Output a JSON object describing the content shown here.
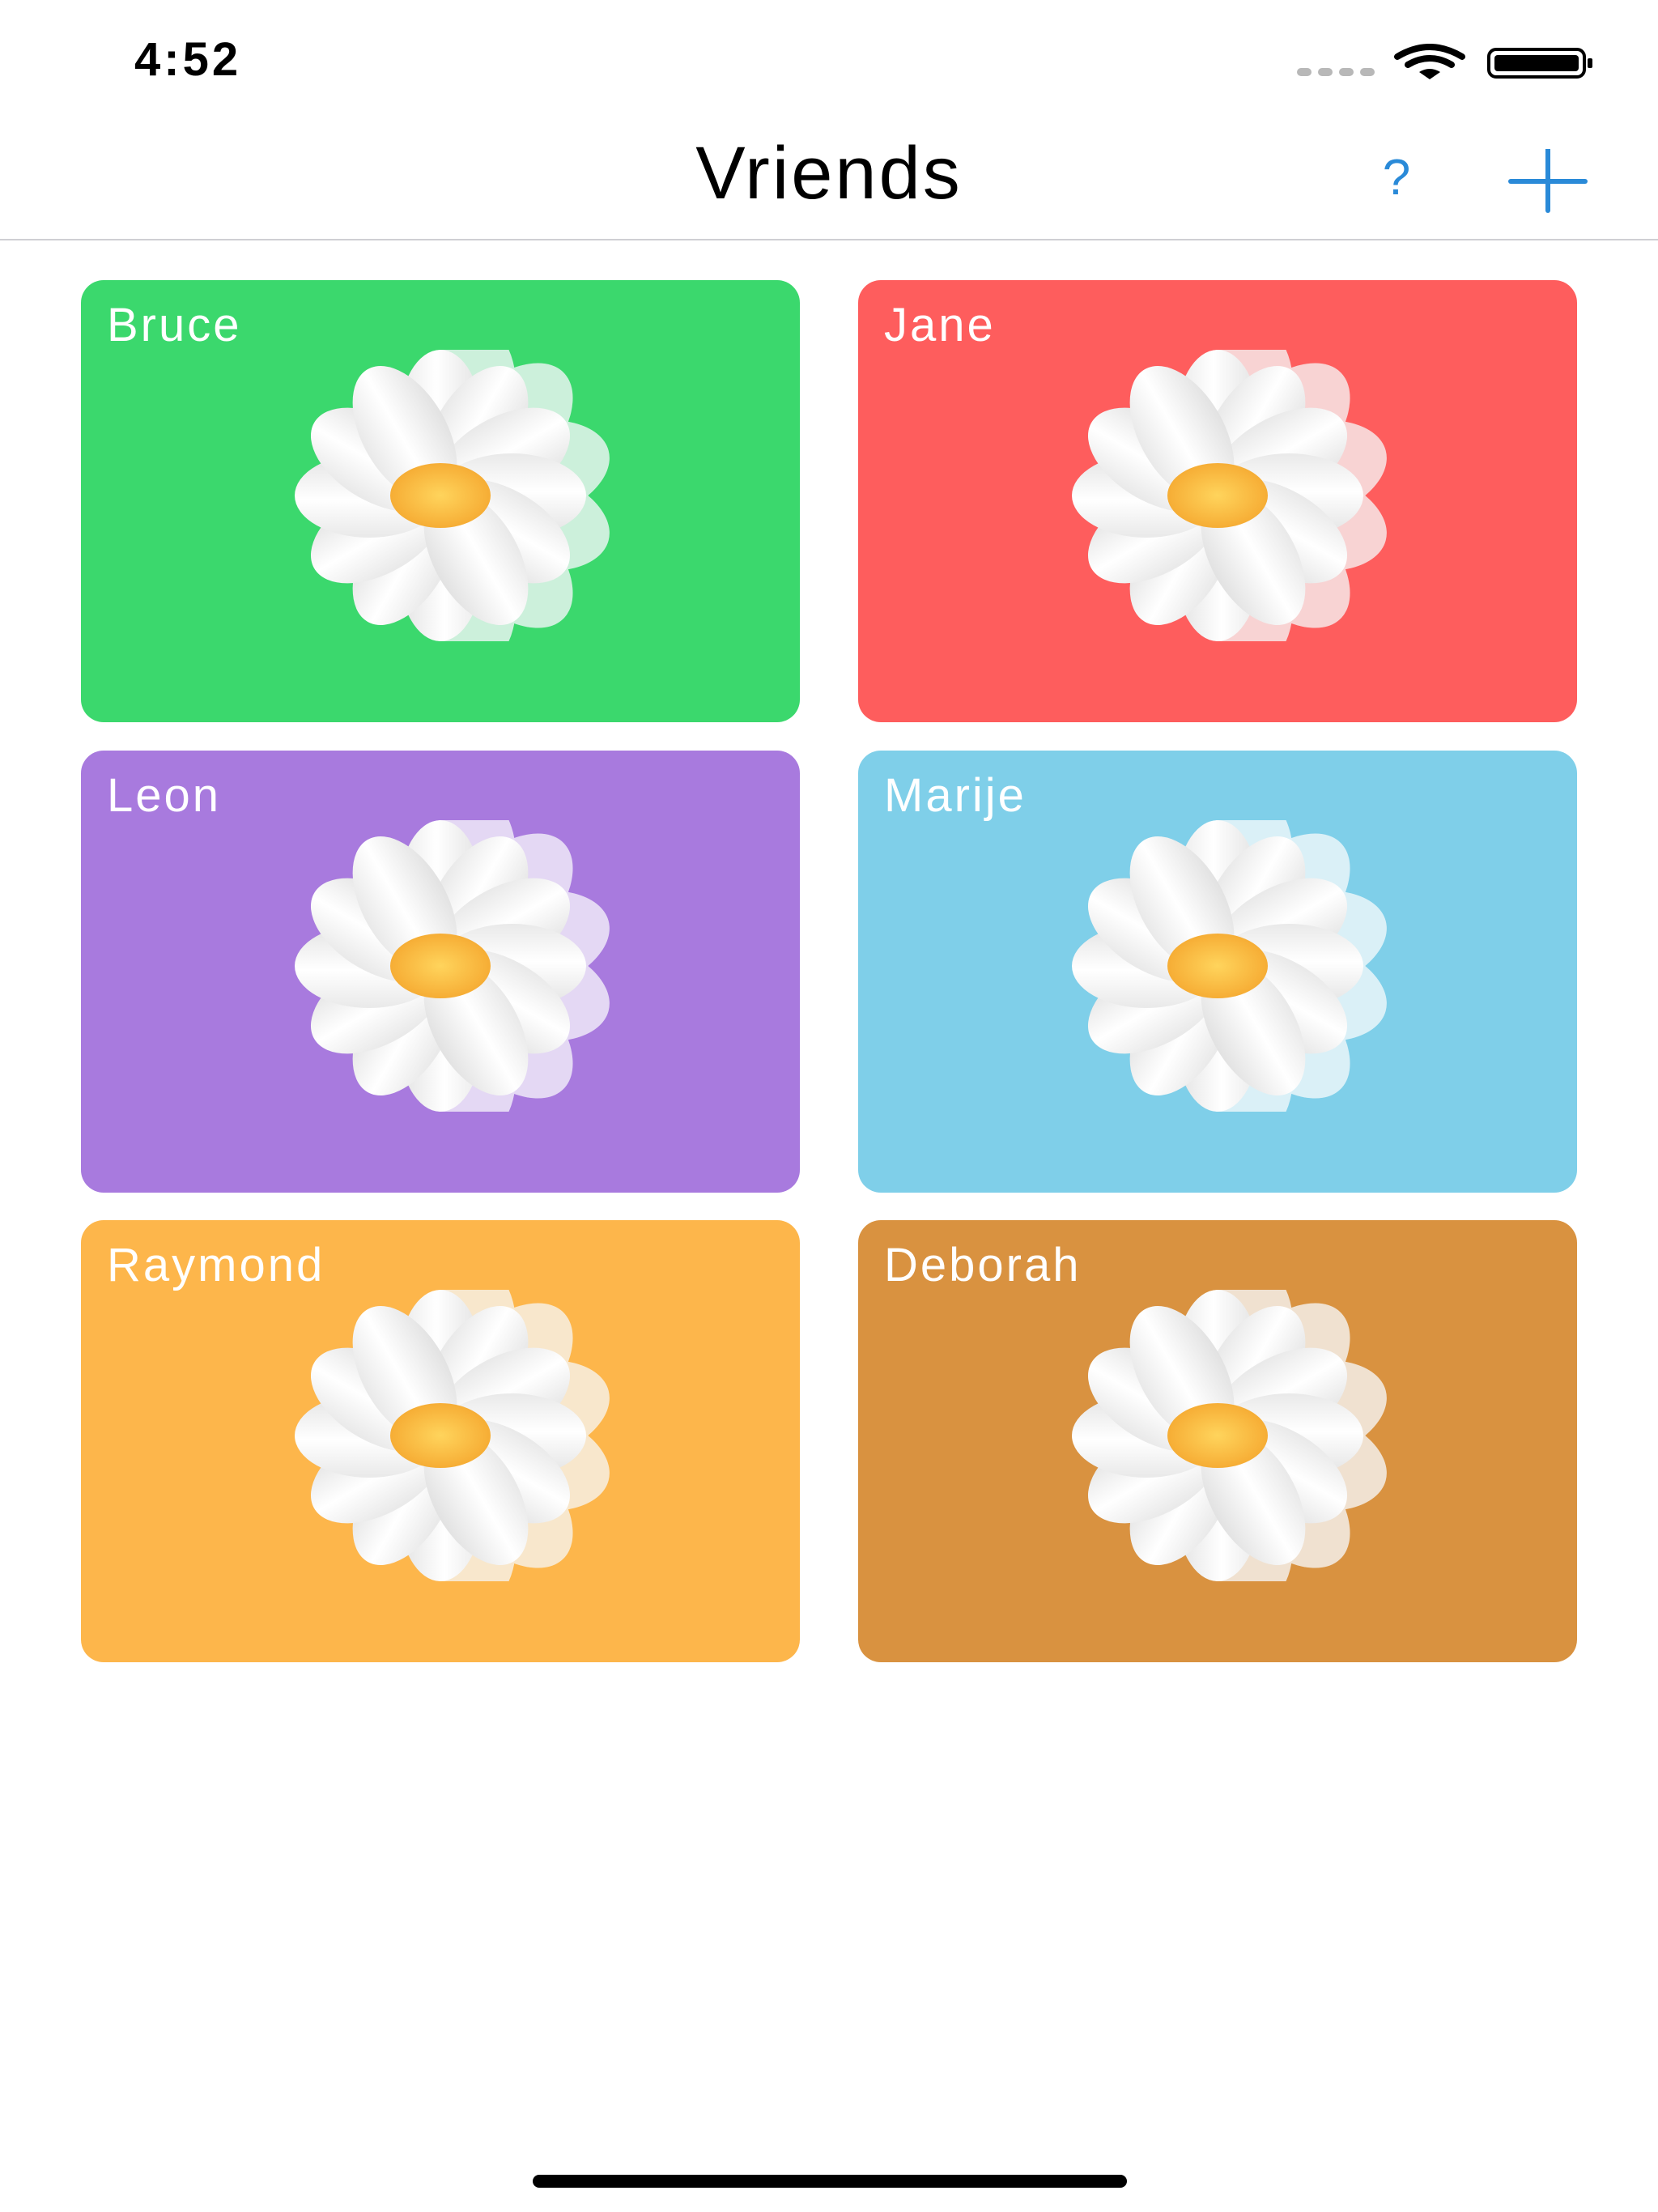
{
  "status_bar": {
    "time": "4:52",
    "signal_icon": "cellular-dots-icon",
    "wifi_icon": "wifi-icon",
    "battery_icon": "battery-icon"
  },
  "nav": {
    "title": "Vriends",
    "help_label": "?",
    "add_icon": "plus-icon",
    "accent_color": "#2a8ad8"
  },
  "friends": [
    {
      "name": "Bruce",
      "color": "#3bd86d",
      "petal_tint": "#d4f1e1"
    },
    {
      "name": "Jane",
      "color": "#fe5d5d",
      "petal_tint": "#f8d9d9"
    },
    {
      "name": "Leon",
      "color": "#a87ade",
      "petal_tint": "#e7ddf4"
    },
    {
      "name": "Marije",
      "color": "#7fcfe9",
      "petal_tint": "#dff1f8"
    },
    {
      "name": "Raymond",
      "color": "#fdb64b",
      "petal_tint": "#f8ead3"
    },
    {
      "name": "Deborah",
      "color": "#d99240",
      "petal_tint": "#f1e6d8"
    }
  ],
  "flower_icon": "daisy-icon"
}
